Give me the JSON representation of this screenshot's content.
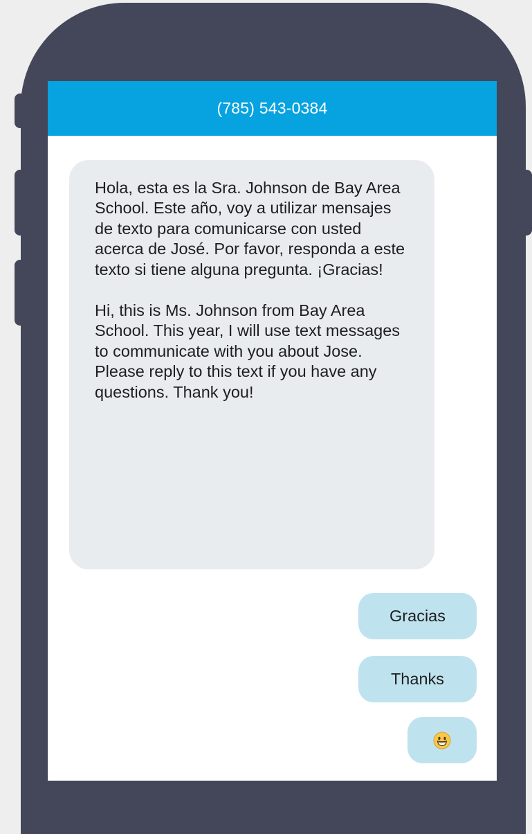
{
  "header": {
    "title": "(785) 543-0384"
  },
  "messages": {
    "incoming": {
      "spanish": "Hola, esta es la Sra. Johnson de Bay Area School. Este año, voy a utilizar mensajes de texto para comunicarse con usted acerca de José. Por favor, responda a este texto si tiene alguna pregunta. ¡Gracias!",
      "english": "Hi, this is Ms. Johnson from Bay Area School. This year, I will use text messages to communicate with you about Jose. Please reply to this text if you have any questions. Thank you!"
    },
    "outgoing": [
      {
        "text": "Gracias"
      },
      {
        "text": "Thanks"
      },
      {
        "icon": "grinning-face-emoji-icon"
      }
    ]
  },
  "colors": {
    "phone_frame": "#444659",
    "header_bg": "#07a3e0",
    "incoming_bubble": "#e9ecef",
    "outgoing_bubble": "#bfe3ee",
    "emoji": "#f7c84a"
  }
}
